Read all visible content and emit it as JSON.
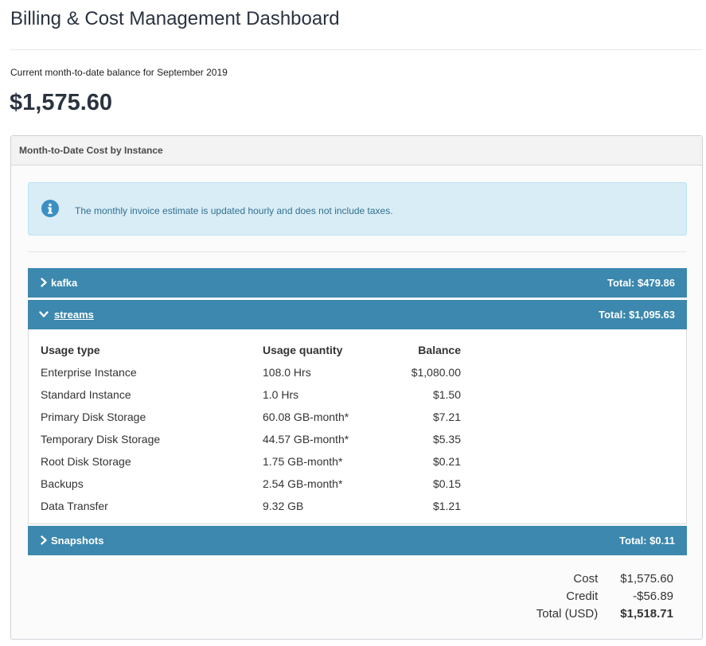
{
  "page": {
    "title": "Billing & Cost Management Dashboard",
    "balance_caption": "Current month-to-date balance for September 2019",
    "balance_amount": "$1,575.60"
  },
  "panel": {
    "title": "Month-to-Date Cost by Instance",
    "info_message": "The monthly invoice estimate is updated hourly and does not include taxes.",
    "info_icon": "info-circle-icon",
    "accent_color": "#3c88ae"
  },
  "groups": [
    {
      "name": "kafka",
      "total": "Total: $479.86",
      "expanded": false,
      "icon": "chevron-right-icon"
    },
    {
      "name": "streams",
      "total": "Total: $1,095.63",
      "expanded": true,
      "icon": "chevron-down-icon"
    },
    {
      "name": "Snapshots",
      "total": "Total: $0.11",
      "expanded": false,
      "icon": "chevron-right-icon"
    }
  ],
  "usage_table": {
    "headers": {
      "type": "Usage type",
      "quantity": "Usage quantity",
      "balance": "Balance"
    },
    "rows": [
      {
        "type": "Enterprise Instance",
        "quantity": "108.0 Hrs",
        "balance": "$1,080.00"
      },
      {
        "type": "Standard Instance",
        "quantity": "1.0 Hrs",
        "balance": "$1.50"
      },
      {
        "type": "Primary Disk Storage",
        "quantity": "60.08 GB-month*",
        "balance": "$7.21"
      },
      {
        "type": "Temporary Disk Storage",
        "quantity": "44.57 GB-month*",
        "balance": "$5.35"
      },
      {
        "type": "Root Disk Storage",
        "quantity": "1.75 GB-month*",
        "balance": "$0.21"
      },
      {
        "type": "Backups",
        "quantity": "2.54 GB-month*",
        "balance": "$0.15"
      },
      {
        "type": "Data Transfer",
        "quantity": "9.32 GB",
        "balance": "$1.21"
      }
    ]
  },
  "summary": {
    "cost_label": "Cost",
    "cost_value": "$1,575.60",
    "credit_label": "Credit",
    "credit_value": "-$56.89",
    "total_label": "Total (USD)",
    "total_value": "$1,518.71"
  }
}
